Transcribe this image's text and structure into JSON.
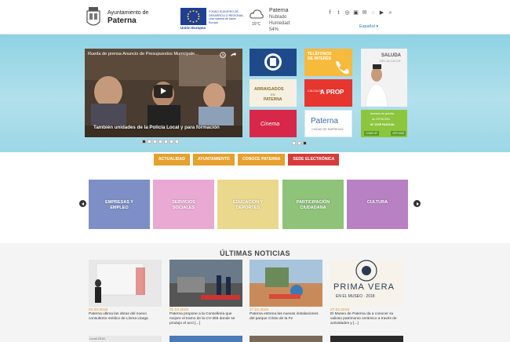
{
  "header": {
    "logo_line1": "Ayuntamiento de",
    "logo_line2": "Paterna",
    "eu_text": "FONDO EUROPEO DE DESARROLLO REGIONAL. Una manera de hacer Europa",
    "eu_caption": "Unión Europea",
    "weather": {
      "temp": "15°C",
      "city": "Paterna",
      "cond": "Nublado",
      "humidity": "Humedad:",
      "humidity_val": "54%"
    },
    "language": "Español ▾"
  },
  "hero": {
    "video_title": "Rueda de prensa Anuncio de Presupuestos Municipale...",
    "video_caption": "También unidades de la Policía Local y para formación",
    "tiles": {
      "telefonos": "TELÉFONOS DE INTERÉS",
      "arraigados_l1": "ARRAIGADOS",
      "arraigados_l2": "EN",
      "arraigados_l3": "PATERNA",
      "aprop_l1": "L'ALCALDE",
      "aprop_l2": "A PROP",
      "paterna_brand": "Paterna",
      "paterna_sub": "CIUDAD DE EMPRESAS",
      "cinema": "Cinema",
      "saluda_l1": "SALUDA",
      "saluda_l2": "DEL ALCALDE",
      "ferm_l1": "farmacia de guardia",
      "ferm_l2": "Av. ESTACIÓN",
      "ferm_l3": "Mª JOSÉ PASCUAL",
      "ferm_l4": "COMO IR",
      "ferm_l5": "VER MÁS"
    }
  },
  "buttons": [
    {
      "label": "ACTUALIDAD",
      "color": "#e5a02e"
    },
    {
      "label": "AYUNTAMIENTO",
      "color": "#e5a02e"
    },
    {
      "label": "CONOCE PATERNA",
      "color": "#e5a02e"
    },
    {
      "label": "SEDE ELECTRÓNICA",
      "color": "#d83b3b"
    }
  ],
  "categories": [
    {
      "l1": "EMPRESAS Y",
      "l2": "EMPLEO",
      "color": "#7d8fc6"
    },
    {
      "l1": "SERVICIOS",
      "l2": "SOCIALES",
      "color": "#e9a9d3"
    },
    {
      "l1": "EDUCACIÓN Y",
      "l2": "DEPORTES",
      "color": "#ead98c"
    },
    {
      "l1": "PARTICIPACIÓN",
      "l2": "CIUDADANA",
      "color": "#8ec379"
    },
    {
      "l1": "CULTURA",
      "l2": "",
      "color": "#b781c4"
    }
  ],
  "news": {
    "title": "ÚLTIMAS NOTICIAS",
    "items": [
      {
        "date": "01.03.2018",
        "text": "Paterna ultima las obras del nuevo consultorio médico de Lloma Llarga"
      },
      {
        "date": "01.03.2018",
        "text": "Paterna propone a la Conselleria que mejore el tramo de la CV-365 donde se produjo el acci [...]"
      },
      {
        "date": "27.02.2018",
        "text": "Paterna estrena las nuevas instalaciones del parque Cristo de la Fe"
      },
      {
        "date": "27.02.2018",
        "text": "El Museo de Paterna da a conocer su valioso patrimonio cerámico a través de actividades y [...]"
      }
    ],
    "museum_l1": "PRIMA",
    "museum_l2": "VERA",
    "museum_l3": "EN EL MUSEO · 2018",
    "next_label": "Local 2018"
  }
}
